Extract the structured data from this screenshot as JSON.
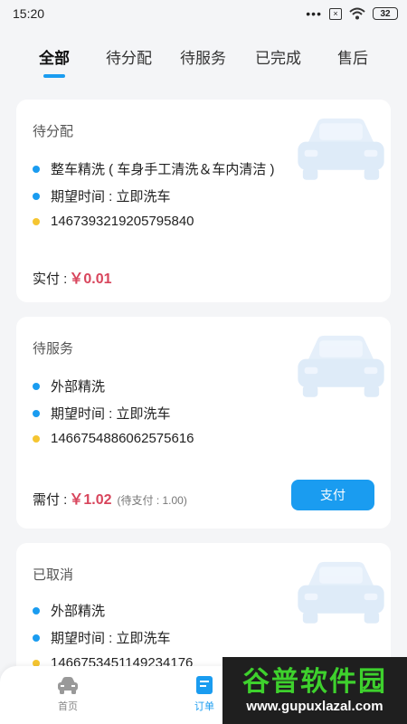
{
  "status_bar": {
    "time": "15:20",
    "signal": "•••",
    "sim": "×",
    "battery": "32"
  },
  "tabs": [
    {
      "label": "全部",
      "active": true
    },
    {
      "label": "待分配",
      "active": false
    },
    {
      "label": "待服务",
      "active": false
    },
    {
      "label": "已完成",
      "active": false
    },
    {
      "label": "售后",
      "active": false
    }
  ],
  "orders": [
    {
      "status": "待分配",
      "service": "整车精洗 ( 车身手工清洗＆车内清洁 )",
      "time": "期望时间 : 立即洗车",
      "order_no": "1467393219205795840",
      "price_label": "实付 :",
      "price": "￥0.01"
    },
    {
      "status": "待服务",
      "service": "外部精洗",
      "time": "期望时间 : 立即洗车",
      "order_no": "1466754886062575616",
      "price_label": "需付 :",
      "price": "￥1.02",
      "price_note": "(待支付 : 1.00)",
      "button": "支付"
    },
    {
      "status": "已取消",
      "service": "外部精洗",
      "time": "期望时间 : 立即洗车",
      "order_no": "1466753451149234176"
    }
  ],
  "bottom_nav": [
    {
      "label": "首页",
      "icon": "car-icon"
    },
    {
      "label": "订单",
      "icon": "order-icon"
    }
  ],
  "watermark": {
    "title": "谷普软件园",
    "url": "www.gupuxlazal.com"
  },
  "colors": {
    "accent": "#1a9cf0",
    "price": "#d8455c",
    "dot_yellow": "#f5c531"
  }
}
